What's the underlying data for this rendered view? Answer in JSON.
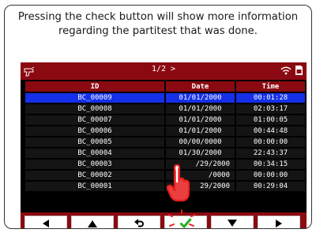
{
  "caption": "Pressing the check button will show more information regarding the partitest that was done.",
  "screen": {
    "page_indicator": "1/2 >",
    "table": {
      "headers": [
        "ID",
        "Date",
        "Time"
      ],
      "rows": [
        {
          "id": "BC_00009",
          "date": "01/01/2000",
          "time": "00:01:28",
          "selected": true
        },
        {
          "id": "BC_00008",
          "date": "01/01/2000",
          "time": "02:03:17",
          "selected": false
        },
        {
          "id": "BC_00007",
          "date": "01/01/2000",
          "time": "01:00:05",
          "selected": false
        },
        {
          "id": "BC_00006",
          "date": "01/01/2000",
          "time": "00:44:48",
          "selected": false
        },
        {
          "id": "BC_00005",
          "date": "00/00/0000",
          "time": "00:00:00",
          "selected": false
        },
        {
          "id": "BC_00004",
          "date": "01/30/2000",
          "time": "22:43:37",
          "selected": false
        },
        {
          "id": "BC_00003",
          "date": "/29/2000",
          "time": "00:34:15",
          "selected": false
        },
        {
          "id": "BC_00002",
          "date": "/0000",
          "time": "00:00:00",
          "selected": false
        },
        {
          "id": "BC_00001",
          "date": "29/2000",
          "time": "00:29:04",
          "selected": false
        }
      ]
    },
    "toolbar": {
      "buttons": [
        {
          "name": "left-arrow-button",
          "icon": "left-triangle-icon"
        },
        {
          "name": "up-arrow-button",
          "icon": "up-triangle-icon"
        },
        {
          "name": "back-button",
          "icon": "return-arrow-icon"
        },
        {
          "name": "check-button",
          "icon": "checkmark-icon"
        },
        {
          "name": "down-arrow-button",
          "icon": "down-triangle-icon"
        },
        {
          "name": "right-arrow-button",
          "icon": "right-triangle-icon"
        }
      ]
    },
    "icons": {
      "left": "scanner-gun-icon",
      "right": [
        "wifi-icon",
        "sd-card-icon"
      ],
      "pointer": "pointing-hand-icon"
    },
    "colors": {
      "header_red": "#8b0a12",
      "selected_blue": "#1530e8",
      "row_black": "#141414",
      "check_green": "#1fb11f",
      "tap_burst_red": "#e81d1d"
    }
  }
}
